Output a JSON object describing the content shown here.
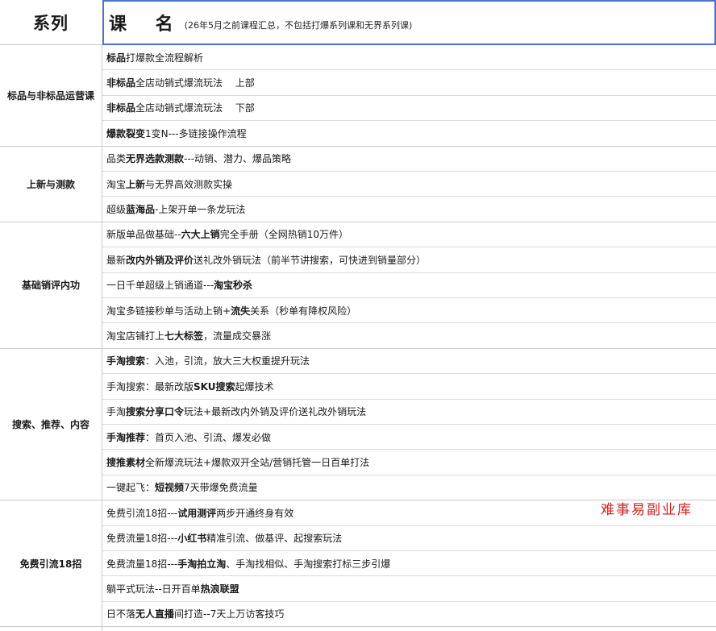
{
  "header": {
    "series_label": "系列",
    "course_label": "课 名",
    "course_note": "(26年5月之前课程汇总，不包括打爆系列课和无界系列课)"
  },
  "groups": [
    {
      "name": "标品与非标品运营课",
      "rows": [
        [
          {
            "t": "标品",
            "b": true
          },
          {
            "t": "打爆款全流程解析",
            "b": false
          }
        ],
        [
          {
            "t": "非标品",
            "b": true
          },
          {
            "t": "全店动销式爆流玩法　 上部",
            "b": false
          }
        ],
        [
          {
            "t": "非标品",
            "b": true
          },
          {
            "t": "全店动销式爆流玩法　 下部",
            "b": false
          }
        ],
        [
          {
            "t": "爆款裂变",
            "b": true
          },
          {
            "t": "1变N---多链接操作流程",
            "b": false
          }
        ]
      ]
    },
    {
      "name": "上新与测款",
      "rows": [
        [
          {
            "t": "品类",
            "b": false
          },
          {
            "t": "无界选款测款",
            "b": true
          },
          {
            "t": "---动销、潜力、爆品策略",
            "b": false
          }
        ],
        [
          {
            "t": "淘宝",
            "b": false
          },
          {
            "t": "上新",
            "b": true
          },
          {
            "t": "与无界高效测款实操",
            "b": false
          }
        ],
        [
          {
            "t": "超级",
            "b": false
          },
          {
            "t": "蓝海品",
            "b": true
          },
          {
            "t": "-上架开单一条龙玩法",
            "b": false
          }
        ]
      ]
    },
    {
      "name": "基础销评内功",
      "rows": [
        [
          {
            "t": "新版单品做基础--",
            "b": false
          },
          {
            "t": "六大上销",
            "b": true
          },
          {
            "t": "完全手册（全网热销10万件）",
            "b": false
          }
        ],
        [
          {
            "t": "最新",
            "b": false
          },
          {
            "t": "改内外销及评价",
            "b": true
          },
          {
            "t": "送礼改外销玩法（前半节讲搜索，可快进到销量部分）",
            "b": false
          }
        ],
        [
          {
            "t": "一日千单超级上销通道---",
            "b": false
          },
          {
            "t": "淘宝秒杀",
            "b": true
          }
        ],
        [
          {
            "t": "淘宝多链接秒单与活动上销+",
            "b": false
          },
          {
            "t": "流失",
            "b": true
          },
          {
            "t": "关系（秒单有降权风险）",
            "b": false
          }
        ],
        [
          {
            "t": "淘宝店铺打上",
            "b": false
          },
          {
            "t": "七大标签",
            "b": true
          },
          {
            "t": "，流量成交暴涨",
            "b": false
          }
        ]
      ]
    },
    {
      "name": "搜索、推荐、内容",
      "rows": [
        [
          {
            "t": "手淘搜索",
            "b": true
          },
          {
            "t": "：入池，引流，放大三大权重提升玩法",
            "b": false
          }
        ],
        [
          {
            "t": "手淘搜索：最新改版",
            "b": false
          },
          {
            "t": "SKU搜索",
            "b": true
          },
          {
            "t": "起爆技术",
            "b": false
          }
        ],
        [
          {
            "t": "手淘",
            "b": false
          },
          {
            "t": "搜索分享口令",
            "b": true
          },
          {
            "t": "玩法+最新改内外销及评价送礼改外销玩法",
            "b": false
          }
        ],
        [
          {
            "t": "手淘推荐",
            "b": true
          },
          {
            "t": "：首页入池、引流、爆发必做",
            "b": false
          }
        ],
        [
          {
            "t": "搜推素材",
            "b": true
          },
          {
            "t": "全新爆流玩法+爆款双开全站/营销托管一日百单打法",
            "b": false
          }
        ],
        [
          {
            "t": "一键起飞：",
            "b": false
          },
          {
            "t": "短视频",
            "b": true
          },
          {
            "t": "7天带爆免费流量",
            "b": false
          }
        ]
      ]
    },
    {
      "name": "免费引流18招",
      "rows": [
        [
          {
            "t": "免费引流18招---",
            "b": false
          },
          {
            "t": "试用测评",
            "b": true
          },
          {
            "t": "两步开通终身有效",
            "b": false
          }
        ],
        [
          {
            "t": "免费流量18招---",
            "b": false
          },
          {
            "t": "小红书",
            "b": true
          },
          {
            "t": "精准引流、做基评、起搜索玩法",
            "b": false
          }
        ],
        [
          {
            "t": "免费流量18招---",
            "b": false
          },
          {
            "t": "手淘拍立淘",
            "b": true
          },
          {
            "t": "、手淘找相似、手淘搜索打标三步引爆",
            "b": false
          }
        ],
        [
          {
            "t": "躺平式玩法--日开百单",
            "b": false
          },
          {
            "t": "热浪联盟",
            "b": true
          }
        ],
        [
          {
            "t": "日不落",
            "b": false
          },
          {
            "t": "无人直播",
            "b": true
          },
          {
            "t": "间打造--7天上万访客技巧",
            "b": false
          }
        ]
      ]
    }
  ],
  "watermark": "难事易副业库"
}
